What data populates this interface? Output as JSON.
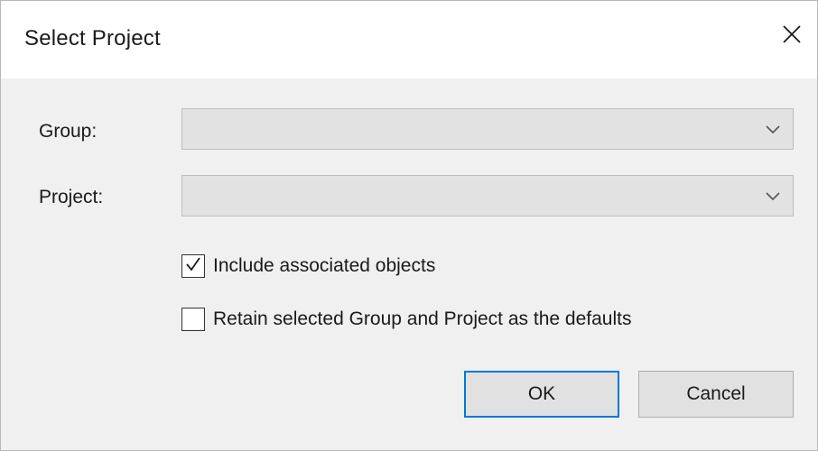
{
  "dialog": {
    "title": "Select Project",
    "close_icon": "close-icon"
  },
  "group": {
    "label": "Group:",
    "value": "",
    "icon": "chevron-down-icon"
  },
  "project": {
    "label": "Project:",
    "value": "",
    "icon": "chevron-down-icon"
  },
  "options": {
    "include_associated": {
      "label": "Include associated objects",
      "checked": true
    },
    "retain_defaults": {
      "label": "Retain selected Group and Project as the defaults",
      "checked": false
    }
  },
  "buttons": {
    "ok_label": "OK",
    "cancel_label": "Cancel"
  },
  "colors": {
    "dialog_bg": "#f0f0f0",
    "titlebar_bg": "#ffffff",
    "combo_bg": "#e2e2e2",
    "default_button_border": "#0078d7"
  }
}
